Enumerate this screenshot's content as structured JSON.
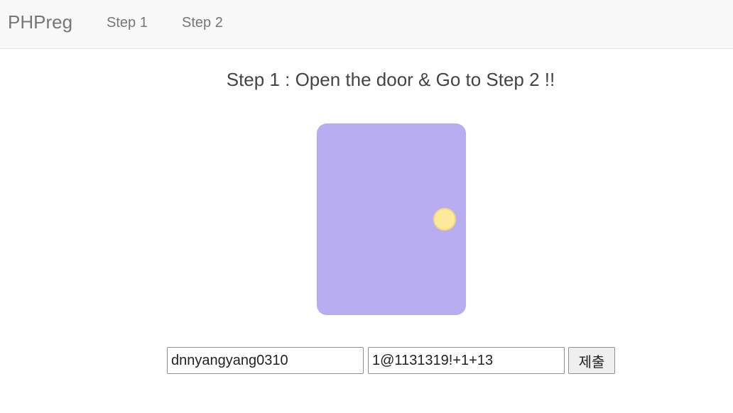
{
  "navbar": {
    "brand": "PHPreg",
    "links": [
      {
        "label": "Step 1"
      },
      {
        "label": "Step 2"
      }
    ]
  },
  "main": {
    "heading": "Step 1 : Open the door & Go to Step 2 !!",
    "door": {
      "color": "#b8adf1",
      "knob_color": "#fde99a"
    },
    "form": {
      "first_field_value": "dnnyangyang0310",
      "second_field_value": "1@1131319!+1+13",
      "submit_label": "제출"
    }
  }
}
